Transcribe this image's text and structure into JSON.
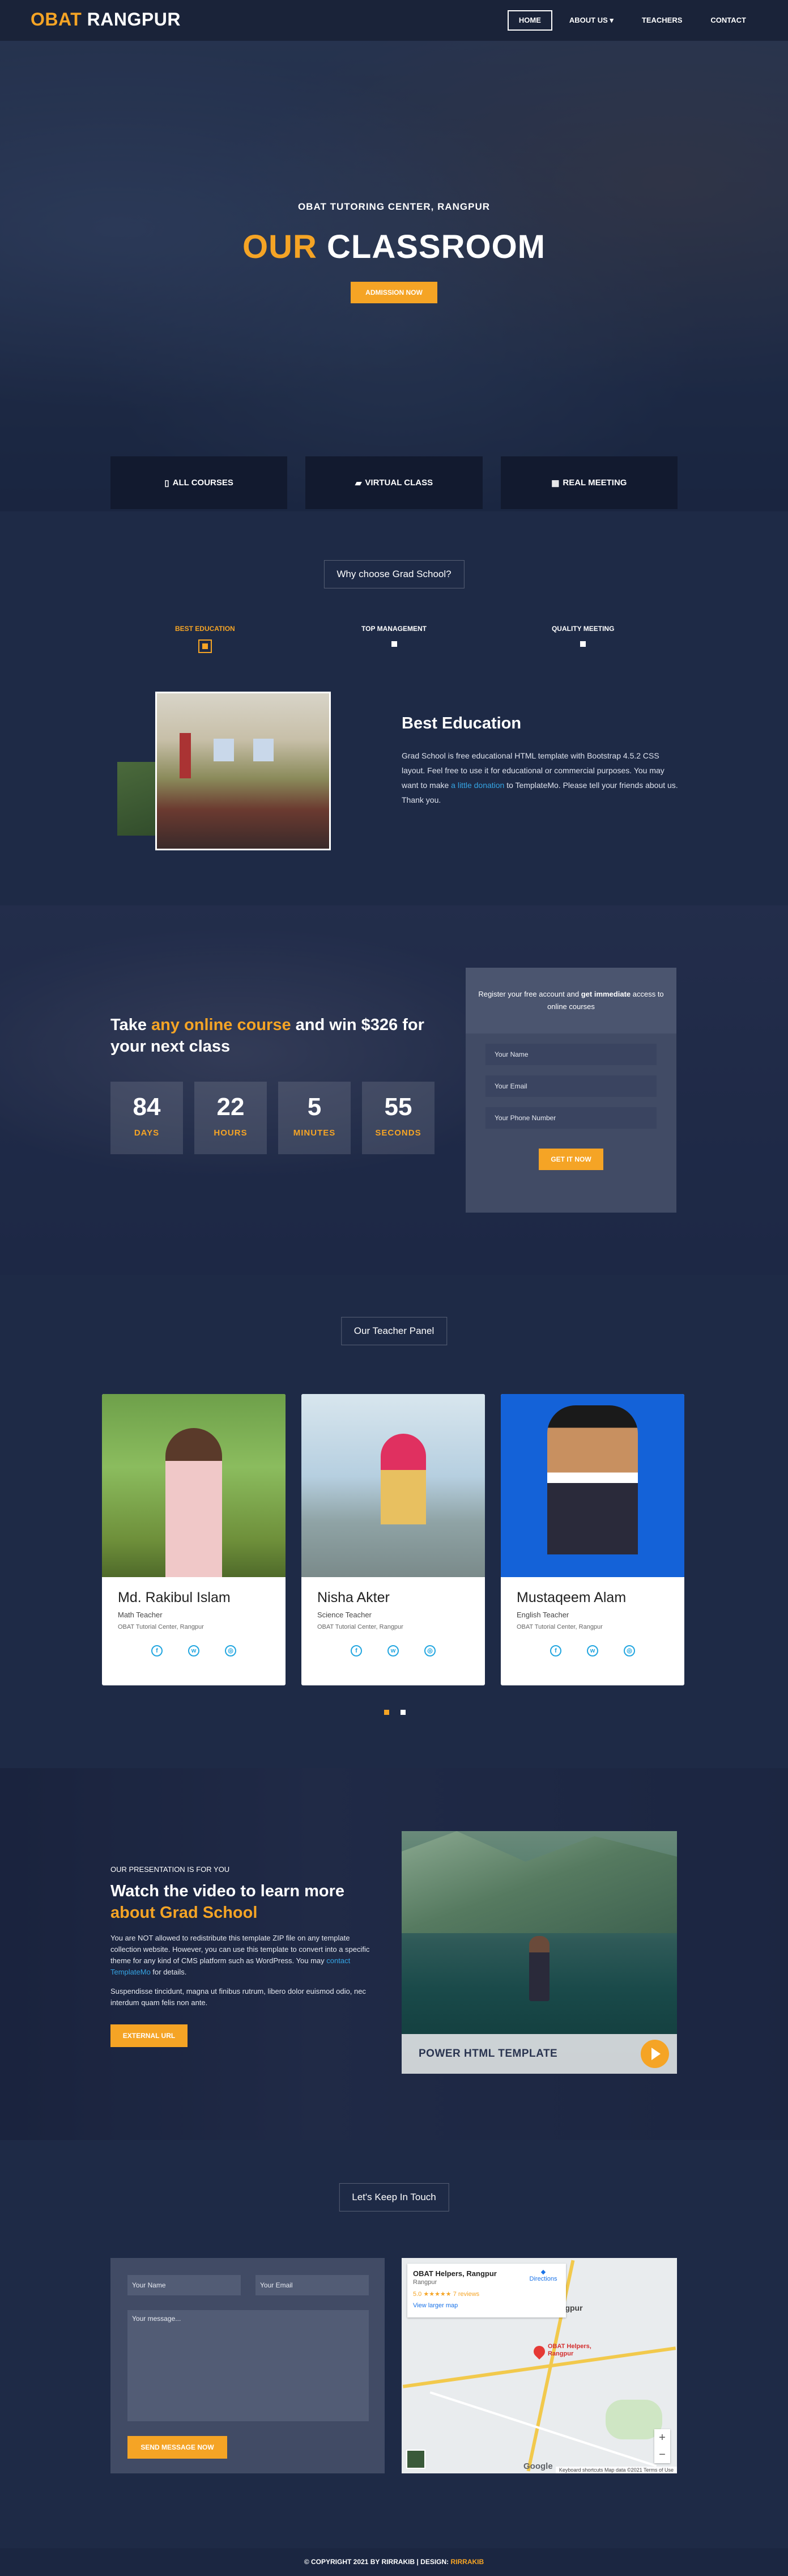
{
  "brand": {
    "accent": "OBAT",
    "rest": "RANGPUR"
  },
  "nav": {
    "home": "HOME",
    "about": "ABOUT US ▾",
    "teachers": "TEACHERS",
    "contact": "CONTACT"
  },
  "hero": {
    "subtitle": "OBAT TUTORING CENTER, RANGPUR",
    "title_accent": "OUR",
    "title_rest": "CLASSROOM",
    "button": "ADMISSION NOW"
  },
  "features": [
    "ALL COURSES",
    "VIRTUAL CLASS",
    "REAL MEETING"
  ],
  "why": {
    "heading": "Why choose Grad School?",
    "tabs": [
      "BEST EDUCATION",
      "TOP MANAGEMENT",
      "QUALITY MEETING"
    ],
    "title": "Best Education",
    "text_a": "Grad School is free educational HTML template with Bootstrap 4.5.2 CSS layout. Feel free to use it for educational or commercial purposes. You may want to make ",
    "text_link": "a little donation",
    "text_b": " to TemplateMo. Please tell your friends about us. Thank you."
  },
  "countdown": {
    "title_a": "Take ",
    "title_accent": "any online course",
    "title_b": " and win $326 for your next class",
    "timer": [
      {
        "num": "84",
        "unit": "DAYS"
      },
      {
        "num": "22",
        "unit": "HOURS"
      },
      {
        "num": "5",
        "unit": "MINUTES"
      },
      {
        "num": "55",
        "unit": "SECONDS"
      }
    ],
    "form_head_a": "Register your free account and ",
    "form_head_strong": "get immediate",
    "form_head_b": " access to online courses",
    "fields": [
      "Your Name",
      "Your Email",
      "Your Phone Number"
    ],
    "button": "GET IT NOW"
  },
  "teachers": {
    "heading": "Our Teacher Panel",
    "list": [
      {
        "name": "Md. Rakibul Islam",
        "role": "Math Teacher",
        "org": "OBAT Tutorial Center, Rangpur"
      },
      {
        "name": "Nisha Akter",
        "role": "Science Teacher",
        "org": "OBAT Tutorial Center, Rangpur"
      },
      {
        "name": "Mustaqeem Alam",
        "role": "English Teacher",
        "org": "OBAT Tutorial Center, Rangpur"
      }
    ]
  },
  "video": {
    "kicker": "OUR PRESENTATION IS FOR YOU",
    "title_a": "Watch the video to learn more ",
    "title_accent": "about Grad School",
    "p1_a": "You are NOT allowed to redistribute this template ZIP file on any template collection website. However, you can use this template to convert into a specific theme for any kind of CMS platform such as WordPress. You may ",
    "p1_link": "contact TemplateMo",
    "p1_b": " for details.",
    "p2": "Suspendisse tincidunt, magna ut finibus rutrum, libero dolor euismod odio, nec interdum quam felis non ante.",
    "button": "EXTERNAL URL",
    "panel_label": "POWER HTML TEMPLATE"
  },
  "contact": {
    "heading": "Let's Keep In Touch",
    "name_ph": "Your Name",
    "email_ph": "Your Email",
    "msg_ph": "Your message...",
    "button": "SEND MESSAGE NOW",
    "map": {
      "place": "OBAT Helpers, Rangpur",
      "place_sub": "Rangpur",
      "rating": "5.0 ★★★★★  7 reviews",
      "view": "View larger map",
      "directions": "Directions",
      "city": "Rangpur",
      "pin": "OBAT Helpers, Rangpur",
      "attribution": "Keyboard shortcuts  Map data ©2021  Terms of Use",
      "google": "Google"
    }
  },
  "footer": {
    "text": "© COPYRIGHT 2021 BY RIRRAKIB | DESIGN: ",
    "accent": "RIRRAKIB"
  }
}
